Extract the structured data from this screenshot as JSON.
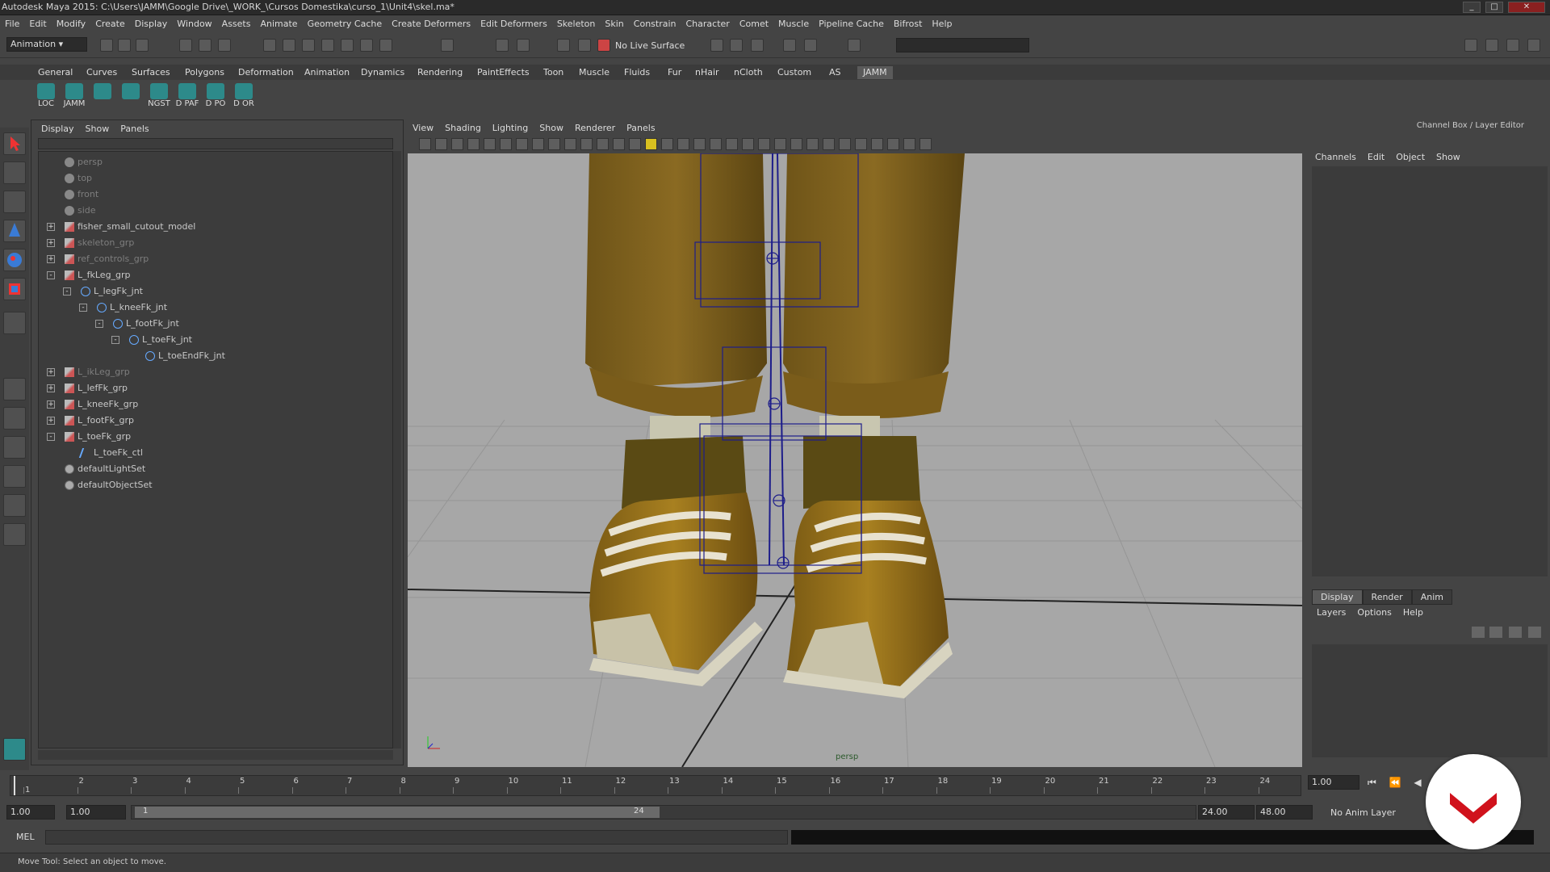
{
  "window": {
    "title": "Autodesk Maya 2015: C:\\Users\\JAMM\\Google Drive\\_WORK_\\Cursos Domestika\\curso_1\\Unit4\\skel.ma*"
  },
  "menubar": [
    "File",
    "Edit",
    "Modify",
    "Create",
    "Display",
    "Window",
    "Assets",
    "Animate",
    "Geometry Cache",
    "Create Deformers",
    "Edit Deformers",
    "Skeleton",
    "Skin",
    "Constrain",
    "Character",
    "Comet",
    "Muscle",
    "Pipeline Cache",
    "Bifrost",
    "Help"
  ],
  "statusline": {
    "mode": "Animation",
    "live_surface": "No Live Surface"
  },
  "shelf_tabs": [
    "General",
    "Curves",
    "Surfaces",
    "Polygons",
    "Deformation",
    "Animation",
    "Dynamics",
    "Rendering",
    "PaintEffects",
    "Toon",
    "Muscle",
    "Fluids",
    "Fur",
    "nHair",
    "nCloth",
    "Custom",
    "AS",
    "JAMM"
  ],
  "shelf_tab_active": "JAMM",
  "shelf_icons": [
    "LOC",
    "JAMM",
    "",
    "",
    "NGST",
    "D PAF",
    "D PO",
    "D OR"
  ],
  "outliner": {
    "menu": [
      "Display",
      "Show",
      "Panels"
    ],
    "items": [
      {
        "label": "persp",
        "indent": 0,
        "icon": "cam",
        "dim": true,
        "exp": ""
      },
      {
        "label": "top",
        "indent": 0,
        "icon": "cam",
        "dim": true,
        "exp": ""
      },
      {
        "label": "front",
        "indent": 0,
        "icon": "cam",
        "dim": true,
        "exp": ""
      },
      {
        "label": "side",
        "indent": 0,
        "icon": "cam",
        "dim": true,
        "exp": ""
      },
      {
        "label": "fisher_small_cutout_model",
        "indent": 0,
        "icon": "grp",
        "dim": false,
        "exp": "+"
      },
      {
        "label": "skeleton_grp",
        "indent": 0,
        "icon": "grp",
        "dim": true,
        "exp": "+"
      },
      {
        "label": "ref_controls_grp",
        "indent": 0,
        "icon": "grp",
        "dim": true,
        "exp": "+"
      },
      {
        "label": "L_fkLeg_grp",
        "indent": 0,
        "icon": "grp",
        "dim": false,
        "exp": "-"
      },
      {
        "label": "L_legFk_jnt",
        "indent": 1,
        "icon": "jnt",
        "dim": false,
        "exp": "-"
      },
      {
        "label": "L_kneeFk_jnt",
        "indent": 2,
        "icon": "jnt",
        "dim": false,
        "exp": "-"
      },
      {
        "label": "L_footFk_jnt",
        "indent": 3,
        "icon": "jnt",
        "dim": false,
        "exp": "-"
      },
      {
        "label": "L_toeFk_jnt",
        "indent": 4,
        "icon": "jnt",
        "dim": false,
        "exp": "-"
      },
      {
        "label": "L_toeEndFk_jnt",
        "indent": 5,
        "icon": "jnt",
        "dim": false,
        "exp": ""
      },
      {
        "label": "L_ikLeg_grp",
        "indent": 0,
        "icon": "grp",
        "dim": true,
        "exp": "+"
      },
      {
        "label": "L_lefFk_grp",
        "indent": 0,
        "icon": "grp",
        "dim": false,
        "exp": "+"
      },
      {
        "label": "L_kneeFk_grp",
        "indent": 0,
        "icon": "grp",
        "dim": false,
        "exp": "+"
      },
      {
        "label": "L_footFk_grp",
        "indent": 0,
        "icon": "grp",
        "dim": false,
        "exp": "+"
      },
      {
        "label": "L_toeFk_grp",
        "indent": 0,
        "icon": "grp",
        "dim": false,
        "exp": "-"
      },
      {
        "label": "L_toeFk_ctl",
        "indent": 1,
        "icon": "curve",
        "dim": false,
        "exp": ""
      },
      {
        "label": "defaultLightSet",
        "indent": 0,
        "icon": "set",
        "dim": false,
        "exp": ""
      },
      {
        "label": "defaultObjectSet",
        "indent": 0,
        "icon": "set",
        "dim": false,
        "exp": ""
      }
    ]
  },
  "viewport": {
    "menu": [
      "View",
      "Shading",
      "Lighting",
      "Show",
      "Renderer",
      "Panels"
    ],
    "camera": "persp"
  },
  "channel_box": {
    "header": "Channel Box / Layer Editor",
    "menu": [
      "Channels",
      "Edit",
      "Object",
      "Show"
    ],
    "layer_tabs": [
      "Display",
      "Render",
      "Anim"
    ],
    "layer_menu": [
      "Layers",
      "Options",
      "Help"
    ]
  },
  "timeline": {
    "ticks": [
      "1",
      "2",
      "3",
      "4",
      "5",
      "6",
      "7",
      "8",
      "9",
      "10",
      "11",
      "12",
      "13",
      "14",
      "15",
      "16",
      "17",
      "18",
      "19",
      "20",
      "21",
      "22",
      "23",
      "24"
    ],
    "current_frame": "1.00"
  },
  "range": {
    "start": "1.00",
    "inner_start": "1.00",
    "slider_start": "1",
    "slider_end": "24",
    "end": "24.00",
    "outer_end": "48.00",
    "anim_layer": "No Anim Layer"
  },
  "cmdline": {
    "label": "MEL"
  },
  "helpline": {
    "text": "Move Tool: Select an object to move."
  }
}
